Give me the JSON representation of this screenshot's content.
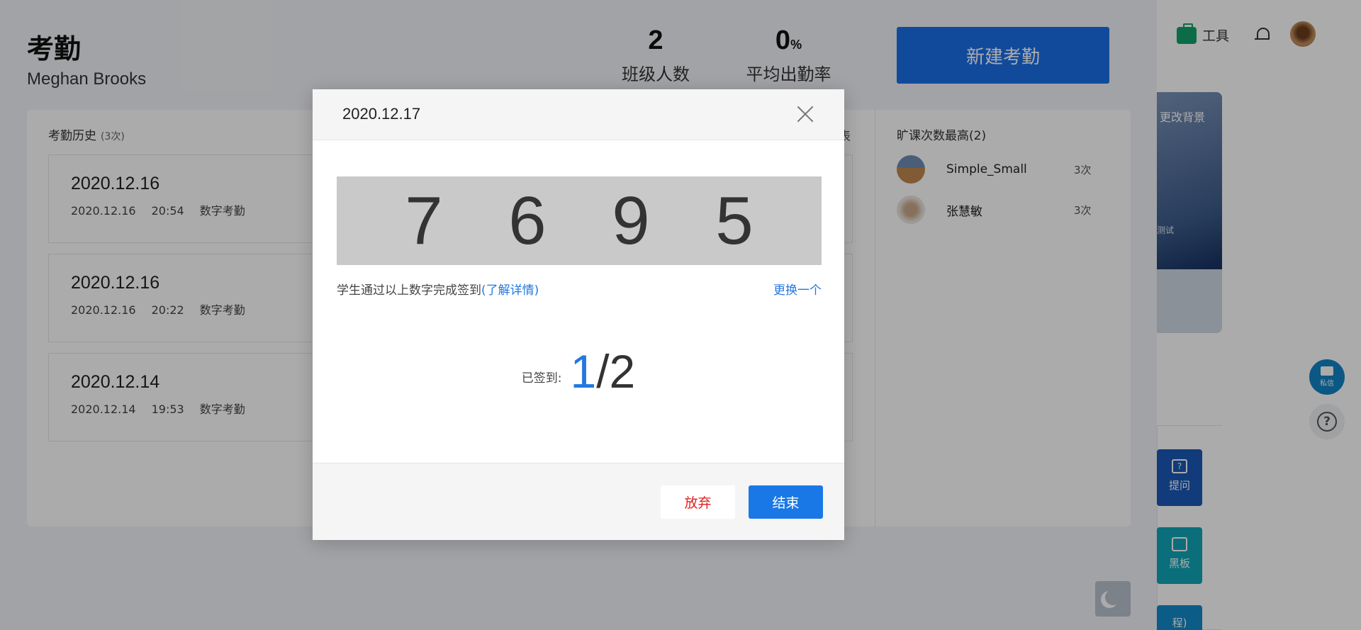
{
  "header": {
    "title": "考勤",
    "teacher": "Meghan Brooks",
    "stats": [
      {
        "value": "2",
        "unit": "",
        "label": "班级人数"
      },
      {
        "value": "0",
        "unit": "%",
        "label": "平均出勤率"
      }
    ],
    "new_button_label": "新建考勤"
  },
  "toolbar": {
    "tools_label": "工具"
  },
  "history": {
    "title": "考勤历史",
    "count": "(3次)",
    "chart_tag": "表",
    "items": [
      {
        "date": "2020.12.16",
        "day": "2020.12.16",
        "time": "20:54",
        "type": "数字考勤"
      },
      {
        "date": "2020.12.16",
        "day": "2020.12.16",
        "time": "20:22",
        "type": "数字考勤"
      },
      {
        "date": "2020.12.14",
        "day": "2020.12.14",
        "time": "19:53",
        "type": "数字考勤"
      }
    ]
  },
  "absent": {
    "title": "旷课次数最高(2)",
    "students": [
      {
        "name": "Simple_Small",
        "count": "3次",
        "avatar_color": "#c08850"
      },
      {
        "name": "张慧敏",
        "count": "3次",
        "avatar_color": "#d9d2c8"
      }
    ]
  },
  "right_panel": {
    "change_bg": "更改背景",
    "bg_sub": "测试",
    "ask": "提问",
    "board": "黑板",
    "course": "程)",
    "msg": "私信",
    "help": "?"
  },
  "dialog": {
    "date": "2020.12.17",
    "code": [
      "7",
      "6",
      "9",
      "5"
    ],
    "hint": "学生通过以上数字完成签到",
    "hint_link": "(了解详情)",
    "swap": "更换一个",
    "signed_label": "已签到:",
    "signed_done": "1",
    "signed_total": "/2",
    "abandon": "放弃",
    "end": "结束"
  },
  "colors": {
    "accent": "#1a78e6",
    "danger": "#e02020"
  }
}
